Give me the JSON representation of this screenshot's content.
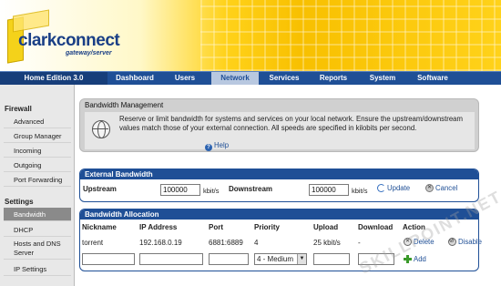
{
  "brand": {
    "name": "clarkconnect",
    "tagline": "gateway/server"
  },
  "nav": {
    "edition": "Home Edition 3.0",
    "items": [
      "Dashboard",
      "Users",
      "Network",
      "Services",
      "Reports",
      "System",
      "Software"
    ],
    "active": "Network"
  },
  "sidebar": {
    "firewall_heading": "Firewall",
    "firewall_items": [
      "Advanced",
      "Group Manager",
      "Incoming",
      "Outgoing",
      "Port Forwarding"
    ],
    "settings_heading": "Settings",
    "settings_items": [
      "Bandwidth",
      "DHCP",
      "Hosts and DNS Server",
      "IP Settings"
    ],
    "active": "Bandwidth"
  },
  "management": {
    "title": "Bandwidth Management",
    "description": "Reserve or limit bandwidth for systems and services on your local network.  Ensure the upstream/downstream values match those of your external connection.  All speeds are specified in kilobits per second.",
    "help_label": "Help"
  },
  "external": {
    "title": "External Bandwidth",
    "upstream_label": "Upstream",
    "upstream_value": "100000",
    "upstream_unit": "kbit/s",
    "downstream_label": "Downstream",
    "downstream_value": "100000",
    "downstream_unit": "kbit/s",
    "update_label": "Update",
    "cancel_label": "Cancel"
  },
  "allocation": {
    "title": "Bandwidth Allocation",
    "headers": [
      "Nickname",
      "IP Address",
      "Port",
      "Priority",
      "Upload",
      "Download",
      "Action"
    ],
    "rows": [
      {
        "nickname": "torrent",
        "ip": "192.168.0.19",
        "port": "6881:6889",
        "priority": "4",
        "upload": "25 kbit/s",
        "download": "-",
        "delete_label": "Delete",
        "disable_label": "Disable"
      }
    ],
    "new_row": {
      "priority_selected": "4 - Medium",
      "add_label": "Add"
    }
  },
  "watermark": "SKILLPOINT.NET",
  "colors": {
    "nav_blue": "#1f4f96",
    "banner_yellow": "#ffd21a"
  }
}
